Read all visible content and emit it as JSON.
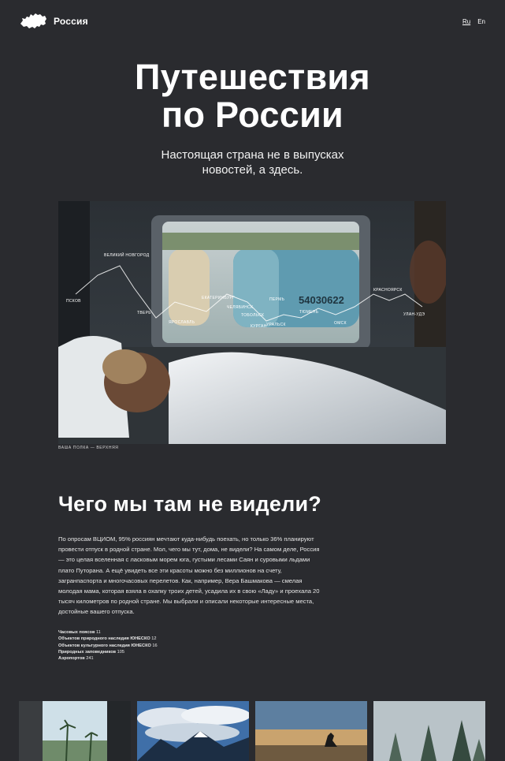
{
  "header": {
    "logo_text": "Россия",
    "logo_icon": "russia-map-icon",
    "languages": [
      "Ru",
      "En"
    ],
    "active_language": "Ru"
  },
  "hero": {
    "title_line1": "Путешествия",
    "title_line2": "по России",
    "subtitle_line1": "Настоящая страна не в выпусках",
    "subtitle_line2": "новостей, а здесь."
  },
  "photo": {
    "caption": "ВАША ПОЛКА — ВЕРХНЯЯ",
    "route_cities": [
      "ПСКОВ",
      "ВЕЛИКИЙ НОВГОРОД",
      "ТВЕРЬ",
      "ЯРОСЛАВЛЬ",
      "ЕКАТЕРИНБУРГ",
      "ЧЕЛЯБИНСК",
      "ТОБОЛЬСК",
      "ПЕРМЬ",
      "КУРГАН",
      "УРАЛЬСК",
      "ТЮМЕНЬ",
      "ОМСК",
      "КРАСНОЯРСК",
      "УЛАН-УДЭ"
    ],
    "train_number": "54030622"
  },
  "section": {
    "heading": "Чего мы там не видели?",
    "paragraph": "По опросам ВЦИОМ, 95% россиян мечтают куда-нибудь поехать, но только 36% планируют провести отпуск в родной стране. Мол, чего мы тут, дома, не видели? На самом деле, Россия — это целая вселенная с ласковым морем юга, густыми лесами Саян и суровыми льдами плато Путорана. А ещё увидеть все эти красоты можно без миллионов на счету, загранпаспорта и многочасовых перелетов. Как, например, Вера Башмакова — смелая молодая мама, которая взяла в охапку троих детей, усадила их в свою «Ладу» и проехала 20 тысяч километров по родной стране. Мы выбрали и описали некоторые интересные места, достойные вашего отпуска."
  },
  "stats": [
    {
      "label": "Часовых поясов",
      "value": "11"
    },
    {
      "label": "Объектов природного наследия ЮНЕСКО",
      "value": "12"
    },
    {
      "label": "Объектов культурного наследия ЮНЕСКО",
      "value": "16"
    },
    {
      "label": "Природных заповедников",
      "value": "105"
    },
    {
      "label": "Аэропортов",
      "value": "241"
    }
  ],
  "gallery": [
    {
      "name": "train-window-palms"
    },
    {
      "name": "mountains-clouds"
    },
    {
      "name": "wolf-sunset"
    },
    {
      "name": "misty-forest"
    }
  ]
}
